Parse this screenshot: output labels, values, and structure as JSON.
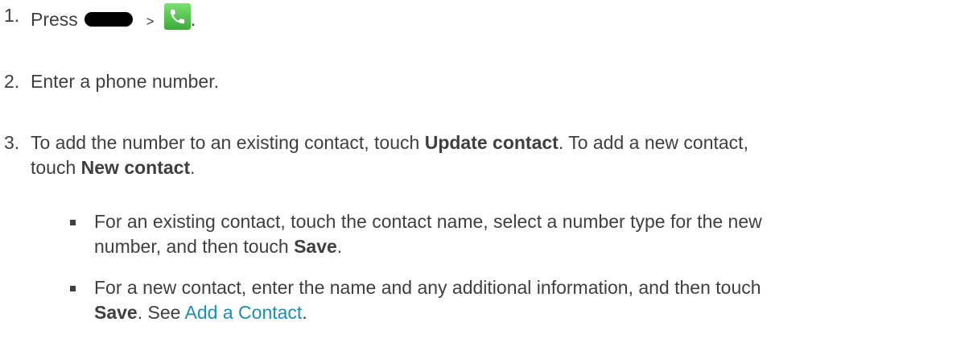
{
  "steps": [
    {
      "number": "1.",
      "press_text": "Press",
      "separator": ">",
      "end_punct": ".",
      "home_button_icon": "home-button-icon",
      "phone_app_icon": "phone-icon"
    },
    {
      "number": "2.",
      "text": "Enter a phone number."
    },
    {
      "number": "3.",
      "text_a": "To add the number to an existing contact, touch ",
      "bold_a": "Update contact",
      "text_b": ". To add a new contact,",
      "text_c": "touch ",
      "bold_b": "New contact",
      "text_d": "."
    }
  ],
  "substeps": [
    {
      "line1": "For an existing contact, touch the contact name, select a number type for the new",
      "line2_a": "number, and then touch ",
      "line2_bold": "Save",
      "line2_b": "."
    },
    {
      "line1": "For a new contact, enter the name and any additional information, and then touch",
      "line2_bold": "Save",
      "line2_a": ". See ",
      "line2_link": "Add a Contact",
      "line2_b": "."
    }
  ],
  "colors": {
    "text": "#3f3f3f",
    "link": "#1c8db8",
    "phone_icon": "#4cbb44"
  }
}
